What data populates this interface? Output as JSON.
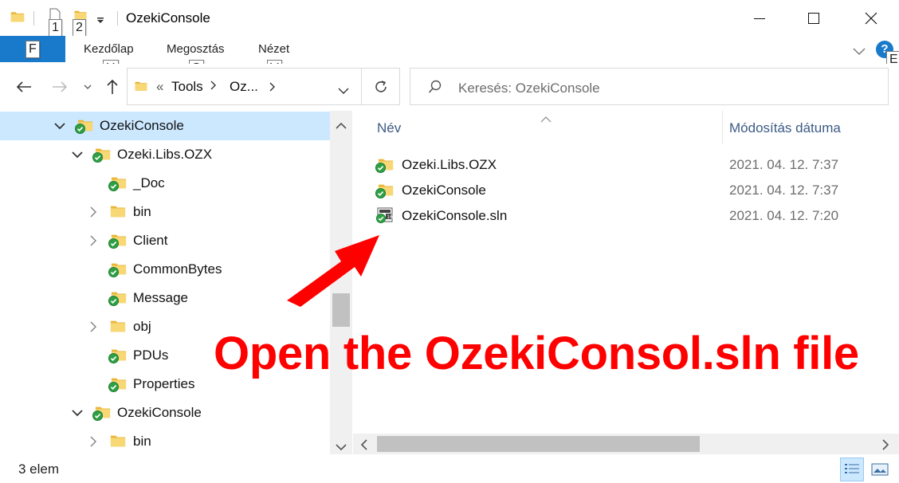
{
  "window": {
    "title": "OzekiConsole",
    "keytips": {
      "qa1": "1",
      "qa2": "2",
      "file": "F",
      "home": "H",
      "share": "S",
      "view": "V",
      "help": "E"
    }
  },
  "ribbon": {
    "tabs": [
      {
        "label": "Kezdőlap"
      },
      {
        "label": "Megosztás"
      },
      {
        "label": "Nézet"
      }
    ],
    "help_label": "?"
  },
  "nav": {
    "path_prefix": "«",
    "path": [
      "Tools",
      "Oz..."
    ],
    "search_placeholder": "Keresés: OzekiConsole"
  },
  "tree": {
    "items": [
      {
        "label": "OzekiConsole",
        "icon": "synced-folder-icon",
        "chevron": "expanded",
        "selected": true
      },
      {
        "label": "Ozeki.Libs.OZX",
        "icon": "synced-folder-icon",
        "chevron": "expanded"
      },
      {
        "label": "_Doc",
        "icon": "synced-folder-icon",
        "chevron": "none"
      },
      {
        "label": "bin",
        "icon": "folder-icon",
        "chevron": "collapsed"
      },
      {
        "label": "Client",
        "icon": "synced-folder-icon",
        "chevron": "collapsed"
      },
      {
        "label": "CommonBytes",
        "icon": "synced-folder-icon",
        "chevron": "none"
      },
      {
        "label": "Message",
        "icon": "synced-folder-icon",
        "chevron": "none"
      },
      {
        "label": "obj",
        "icon": "folder-icon",
        "chevron": "collapsed"
      },
      {
        "label": "PDUs",
        "icon": "synced-folder-icon",
        "chevron": "none"
      },
      {
        "label": "Properties",
        "icon": "synced-folder-icon",
        "chevron": "none"
      },
      {
        "label": "OzekiConsole",
        "icon": "synced-folder-icon",
        "chevron": "expanded"
      },
      {
        "label": "bin",
        "icon": "folder-icon",
        "chevron": "collapsed"
      }
    ]
  },
  "content": {
    "columns": {
      "name": "Név",
      "date": "Módosítás dátuma"
    },
    "files": [
      {
        "name": "Ozeki.Libs.OZX",
        "date": "2021. 04. 12. 7:37",
        "icon": "synced-folder-icon"
      },
      {
        "name": "OzekiConsole",
        "date": "2021. 04. 12. 7:37",
        "icon": "synced-folder-icon"
      },
      {
        "name": "OzekiConsole.sln",
        "date": "2021. 04. 12. 7:20",
        "icon": "vs-solution-file-icon"
      }
    ]
  },
  "status": {
    "count": "3 elem"
  },
  "annotation": {
    "text": "Open the OzekiConsol.sln file",
    "color": "#ff0000"
  },
  "colors": {
    "accent": "#1979ca",
    "selection": "#cce8ff",
    "folder": "#f6c851",
    "sync_green": "#2ea043"
  }
}
